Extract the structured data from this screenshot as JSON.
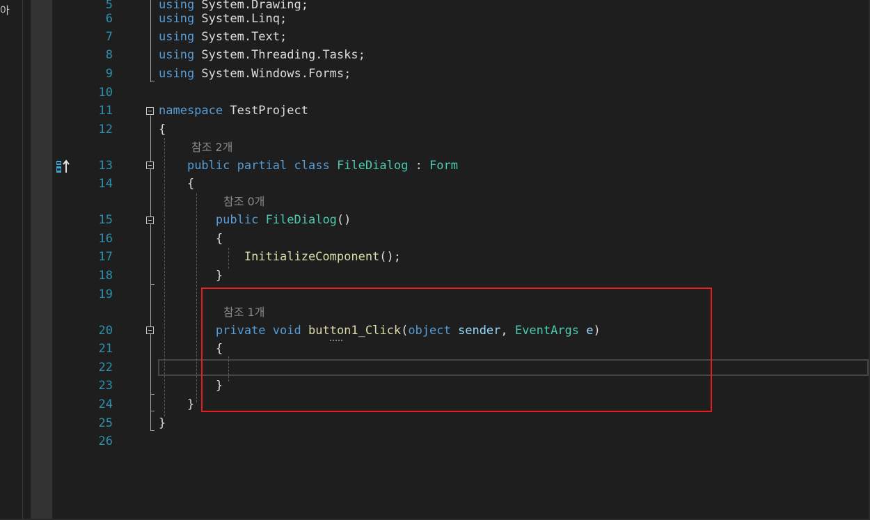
{
  "sidebar": {
    "glyph": "아"
  },
  "lines": [
    {
      "number": "5",
      "parts": [
        [
          "kw",
          "using"
        ],
        [
          "plain",
          " System.Drawing;"
        ]
      ]
    },
    {
      "number": "6",
      "parts": [
        [
          "kw",
          "using"
        ],
        [
          "plain",
          " System.Linq;"
        ]
      ]
    },
    {
      "number": "7",
      "parts": [
        [
          "kw",
          "using"
        ],
        [
          "plain",
          " System.Text;"
        ]
      ]
    },
    {
      "number": "8",
      "parts": [
        [
          "kw",
          "using"
        ],
        [
          "plain",
          " System.Threading.Tasks;"
        ]
      ]
    },
    {
      "number": "9",
      "parts": [
        [
          "kw",
          "using"
        ],
        [
          "plain",
          " System.Windows.Forms;"
        ]
      ]
    },
    {
      "number": "10",
      "parts": []
    },
    {
      "number": "11",
      "parts": [
        [
          "kw",
          "namespace"
        ],
        [
          "plain",
          " TestProject"
        ]
      ]
    },
    {
      "number": "12",
      "parts": [
        [
          "plain",
          "{"
        ]
      ]
    },
    {
      "number": "13",
      "parts": [
        [
          "plain",
          "    "
        ],
        [
          "kw",
          "public"
        ],
        [
          "plain",
          " "
        ],
        [
          "kw",
          "partial"
        ],
        [
          "plain",
          " "
        ],
        [
          "kw",
          "class"
        ],
        [
          "plain",
          " "
        ],
        [
          "type",
          "FileDialog"
        ],
        [
          "plain",
          " : "
        ],
        [
          "type",
          "Form"
        ]
      ]
    },
    {
      "number": "14",
      "parts": [
        [
          "plain",
          "    {"
        ]
      ]
    },
    {
      "number": "15",
      "parts": [
        [
          "plain",
          "        "
        ],
        [
          "kw",
          "public"
        ],
        [
          "plain",
          " "
        ],
        [
          "type",
          "FileDialog"
        ],
        [
          "plain",
          "()"
        ]
      ]
    },
    {
      "number": "16",
      "parts": [
        [
          "plain",
          "        {"
        ]
      ]
    },
    {
      "number": "17",
      "parts": [
        [
          "plain",
          "            "
        ],
        [
          "method",
          "InitializeComponent"
        ],
        [
          "plain",
          "();"
        ]
      ]
    },
    {
      "number": "18",
      "parts": [
        [
          "plain",
          "        }"
        ]
      ]
    },
    {
      "number": "19",
      "parts": []
    },
    {
      "number": "20",
      "parts": [
        [
          "plain",
          "        "
        ],
        [
          "kw",
          "private"
        ],
        [
          "plain",
          " "
        ],
        [
          "kw",
          "void"
        ],
        [
          "plain",
          " "
        ],
        [
          "method",
          "button1_Click"
        ],
        [
          "plain",
          "("
        ],
        [
          "kw",
          "object"
        ],
        [
          "plain",
          " "
        ],
        [
          "param",
          "sender"
        ],
        [
          "plain",
          ", "
        ],
        [
          "type",
          "EventArgs"
        ],
        [
          "plain",
          " "
        ],
        [
          "param",
          "e"
        ],
        [
          "plain",
          ")"
        ]
      ]
    },
    {
      "number": "21",
      "parts": [
        [
          "plain",
          "        {"
        ]
      ]
    },
    {
      "number": "22",
      "parts": []
    },
    {
      "number": "23",
      "parts": [
        [
          "plain",
          "        }"
        ]
      ]
    },
    {
      "number": "24",
      "parts": [
        [
          "plain",
          "    }"
        ]
      ]
    },
    {
      "number": "25",
      "parts": [
        [
          "plain",
          "}"
        ]
      ]
    },
    {
      "number": "26",
      "parts": []
    }
  ],
  "code_lens": {
    "class_refs": "참조 2개",
    "ctor_refs": "참조 0개",
    "method_refs": "참조 1개"
  },
  "colors": {
    "background": "#1e1e1e",
    "keyword": "#569cd6",
    "type": "#4ec9b0",
    "method": "#dcdcaa",
    "line_number": "#2b91af",
    "highlight_box": "#e51c23"
  },
  "icons": {
    "margin_glyph": "git-diff-icon"
  }
}
